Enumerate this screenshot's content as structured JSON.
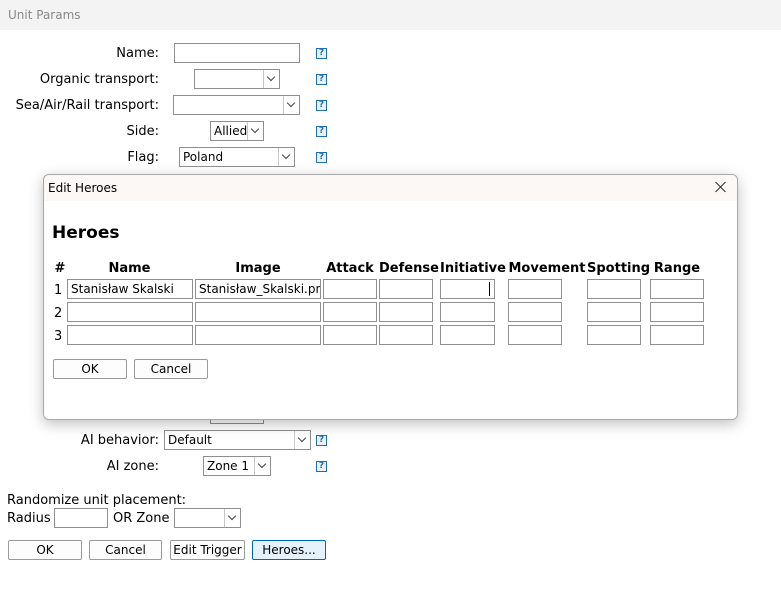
{
  "window": {
    "title": "Unit Params"
  },
  "form": {
    "name_label": "Name:",
    "organic_label": "Organic transport:",
    "sea_label": "Sea/Air/Rail transport:",
    "side_label": "Side:",
    "side_value": "Allied",
    "flag_label": "Flag:",
    "flag_value": "Poland",
    "ai_behavior_label": "AI behavior:",
    "ai_behavior_value": "Default",
    "ai_zone_label": "AI zone:",
    "ai_zone_value": "Zone 1",
    "randomize_label": "Randomize unit placement:",
    "radius_label": "Radius",
    "or_zone_label": "OR Zone",
    "help_glyph": "?"
  },
  "buttons": {
    "ok": "OK",
    "cancel": "Cancel",
    "edit_trigger": "Edit Trigger",
    "heroes": "Heroes..."
  },
  "dialog": {
    "title": "Edit Heroes",
    "heading": "Heroes",
    "columns": [
      "#",
      "Name",
      "Image",
      "Attack",
      "Defense",
      "Initiative",
      "Movement",
      "Spotting",
      "Range"
    ],
    "rows": [
      {
        "num": "1",
        "name": "Stanisław Skalski",
        "image": "Stanisław_Skalski.png"
      },
      {
        "num": "2",
        "name": "",
        "image": ""
      },
      {
        "num": "3",
        "name": "",
        "image": ""
      }
    ],
    "ok": "OK",
    "cancel": "Cancel"
  }
}
